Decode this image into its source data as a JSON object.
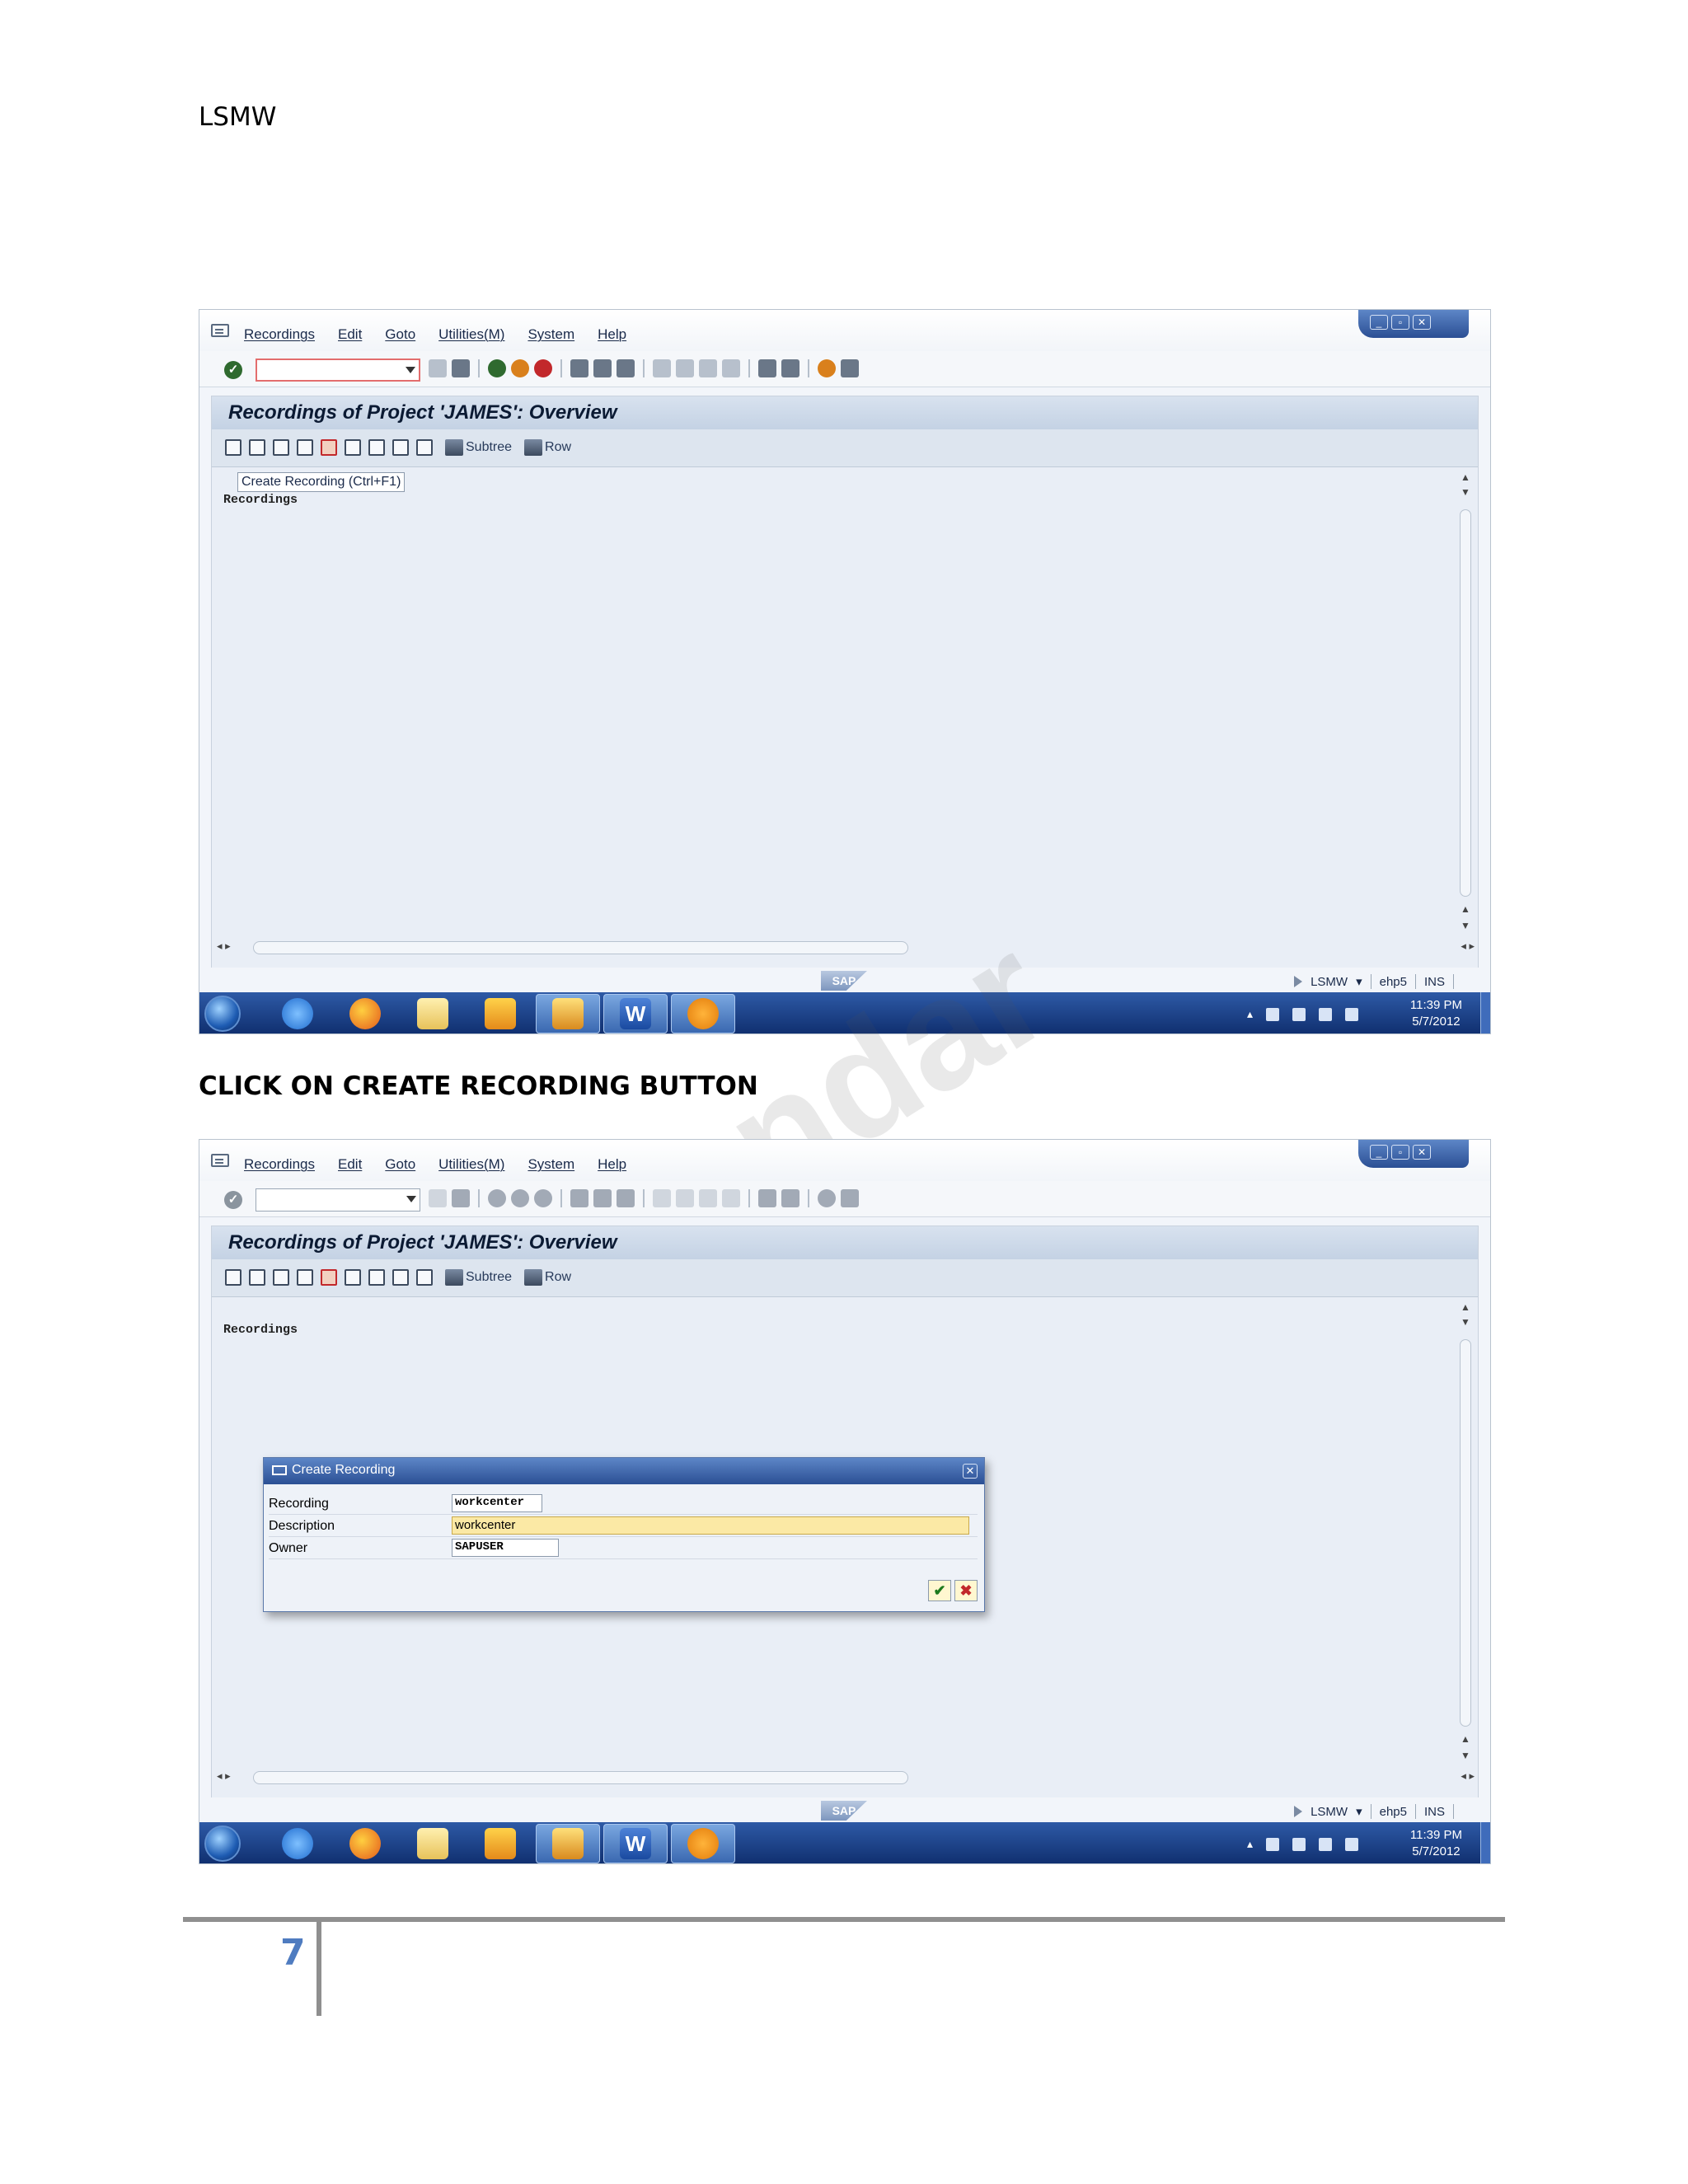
{
  "document": {
    "header": "LSMW",
    "caption": "CLICK ON CREATE RECORDING BUTTON",
    "page_number": "7"
  },
  "sap": {
    "menu": [
      "Recordings",
      "Edit",
      "Goto",
      "Utilities(M)",
      "System",
      "Help"
    ],
    "screen_title": "Recordings of Project 'JAMES': Overview",
    "app_toolbar": {
      "subtree_label": "Subtree",
      "row_label": "Row"
    },
    "tooltip": "Create Recording   (Ctrl+F1)",
    "tree_root_label": "Recordings",
    "status": {
      "transaction": "LSMW",
      "system": "ehp5",
      "mode": "INS"
    },
    "sap_logo_text": "SAP",
    "taskbar": {
      "time": "11:39 PM",
      "date": "5/7/2012"
    }
  },
  "dialog": {
    "title": "Create Recording",
    "fields": {
      "recording_label": "Recording",
      "recording_value": "workcenter",
      "description_label": "Description",
      "description_value": "workcenter",
      "owner_label": "Owner",
      "owner_value": "SAPUSER"
    }
  }
}
